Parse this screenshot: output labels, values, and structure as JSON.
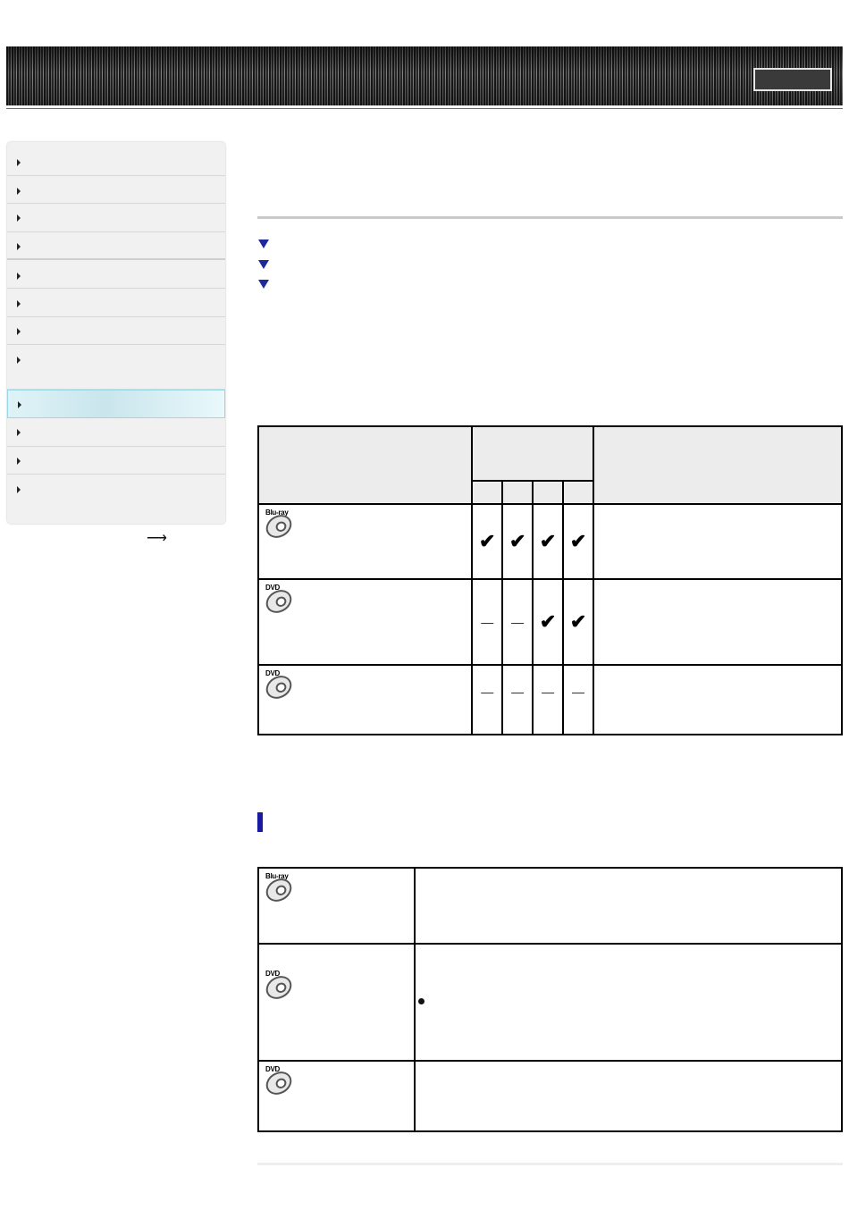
{
  "header": {
    "button_label": ""
  },
  "sidebar": {
    "items": [
      {
        "label": ""
      },
      {
        "label": ""
      },
      {
        "label": ""
      },
      {
        "label": ""
      },
      {
        "label": ""
      },
      {
        "label": ""
      },
      {
        "label": ""
      },
      {
        "label": ""
      },
      {
        "label": "",
        "active": true
      },
      {
        "label": ""
      },
      {
        "label": ""
      },
      {
        "label": ""
      }
    ],
    "next_icon": "right-arrow-icon"
  },
  "main": {
    "jump_links": [
      {
        "label": ""
      },
      {
        "label": ""
      },
      {
        "label": ""
      }
    ],
    "table1": {
      "rows": [
        {
          "disc_label": "Blu-ray",
          "marks": [
            "check",
            "check",
            "check",
            "check"
          ]
        },
        {
          "disc_label": "DVD",
          "marks": [
            "dash",
            "dash",
            "check",
            "check"
          ]
        },
        {
          "disc_label": "DVD",
          "marks": [
            "dash",
            "dash",
            "dash",
            "dash"
          ]
        }
      ]
    },
    "table2": {
      "rows": [
        {
          "disc_label": "Blu-ray"
        },
        {
          "disc_label": "DVD"
        },
        {
          "disc_label": "DVD"
        }
      ]
    }
  },
  "colors": {
    "accent_blue": "#1a1aa0",
    "active_item_bg": "#d6eff4",
    "triangle_blue": "#1f2a9a"
  }
}
